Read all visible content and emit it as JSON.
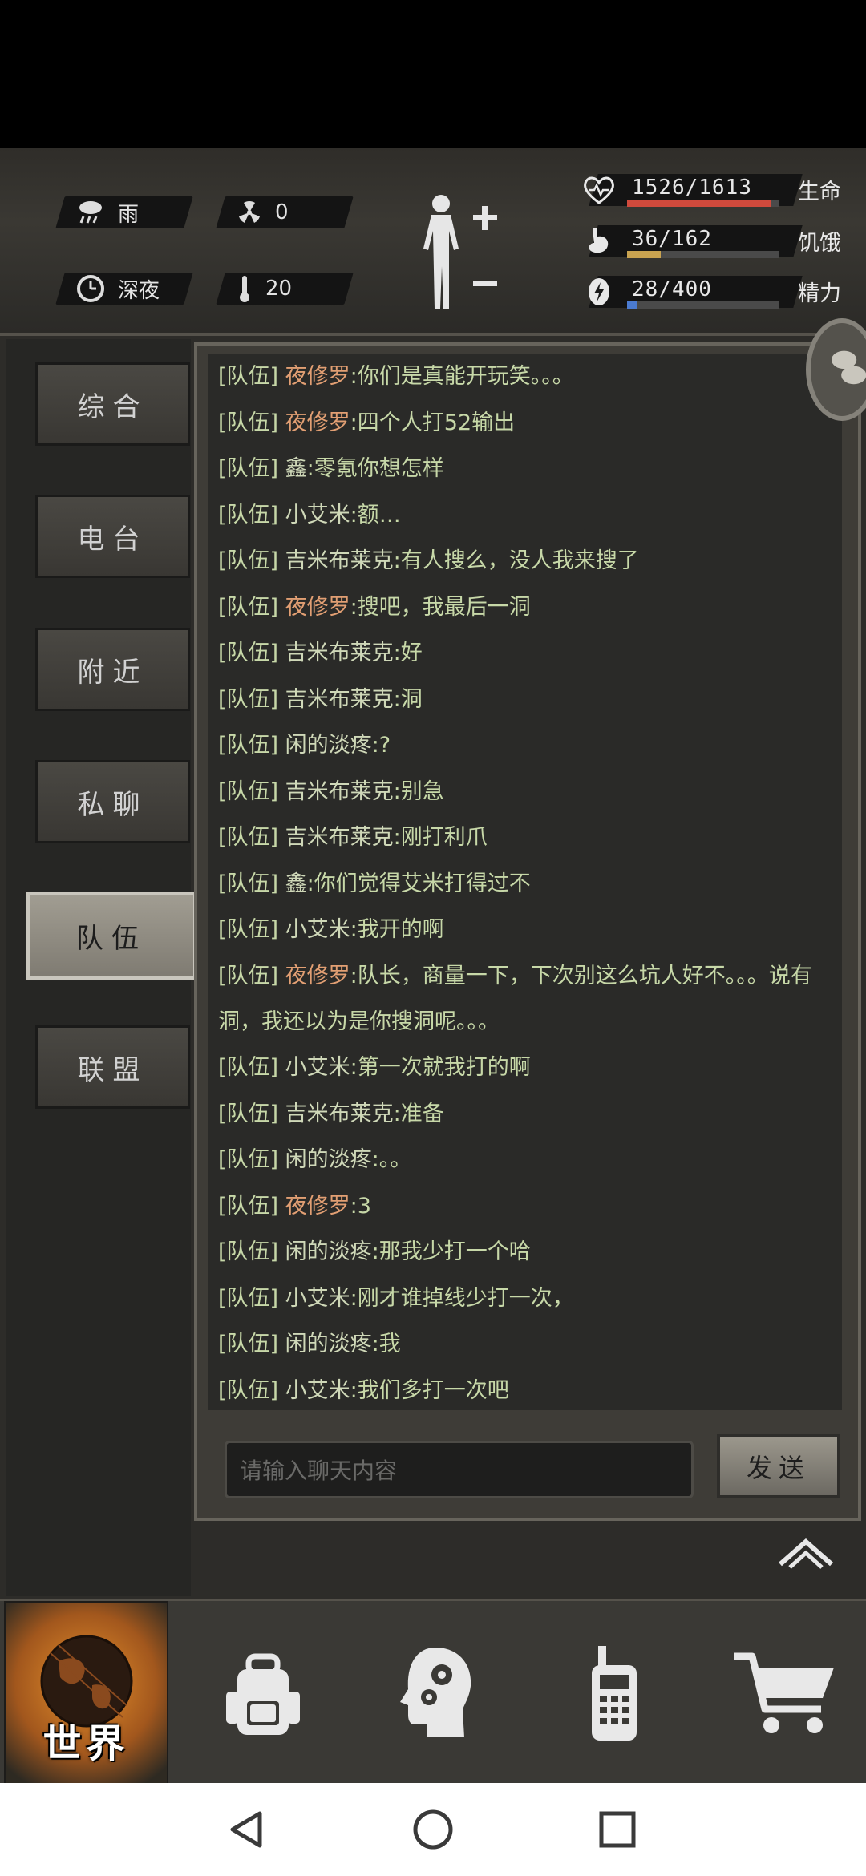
{
  "status": {
    "weather": "雨",
    "radiation": "0",
    "time_of_day": "深夜",
    "temperature": "20",
    "health": {
      "value": "1526/1613",
      "label": "生命",
      "fraction": 0.946,
      "color": "#d04a3c"
    },
    "hunger": {
      "value": "36/162",
      "label": "饥饿",
      "fraction": 0.222,
      "color": "#c9a350"
    },
    "energy": {
      "value": "28/400",
      "label": "精力",
      "fraction": 0.07,
      "color": "#4b7bd1"
    }
  },
  "tabs": [
    {
      "label": "综合"
    },
    {
      "label": "电台"
    },
    {
      "label": "附近"
    },
    {
      "label": "私聊"
    },
    {
      "label": "队伍",
      "active": true
    },
    {
      "label": "联盟"
    }
  ],
  "chat": {
    "messages": [
      {
        "tag": "[队伍]",
        "name": "夜修罗",
        "text": ":你们是真能开玩笑。。。",
        "highlight": true
      },
      {
        "tag": "[队伍]",
        "name": "夜修罗",
        "text": ":四个人打52输出",
        "highlight": true
      },
      {
        "tag": "[队伍]",
        "name": "鑫",
        "text": ":零氪你想怎样",
        "highlight": false
      },
      {
        "tag": "[队伍]",
        "name": "小艾米",
        "text": ":额…",
        "highlight": false
      },
      {
        "tag": "[队伍]",
        "name": "吉米布莱克",
        "text": ":有人搜么，没人我来搜了",
        "highlight": false
      },
      {
        "tag": "[队伍]",
        "name": "夜修罗",
        "text": ":搜吧，我最后一洞",
        "highlight": true
      },
      {
        "tag": "[队伍]",
        "name": "吉米布莱克",
        "text": ":好",
        "highlight": false
      },
      {
        "tag": "[队伍]",
        "name": "吉米布莱克",
        "text": ":洞",
        "highlight": false
      },
      {
        "tag": "[队伍]",
        "name": "闲的淡疼",
        "text": ":?",
        "highlight": false
      },
      {
        "tag": "[队伍]",
        "name": "吉米布莱克",
        "text": ":别急",
        "highlight": false
      },
      {
        "tag": "[队伍]",
        "name": "吉米布莱克",
        "text": ":刚打利爪",
        "highlight": false
      },
      {
        "tag": "[队伍]",
        "name": "鑫",
        "text": ":你们觉得艾米打得过不",
        "highlight": false
      },
      {
        "tag": "[队伍]",
        "name": "小艾米",
        "text": ":我开的啊",
        "highlight": false
      },
      {
        "tag": "[队伍]",
        "name": "夜修罗",
        "text": ":队长，商量一下，下次别这么坑人好不。。。说有洞，我还以为是你搜洞呢。。。",
        "highlight": true
      },
      {
        "tag": "[队伍]",
        "name": "小艾米",
        "text": ":第一次就我打的啊",
        "highlight": false
      },
      {
        "tag": "[队伍]",
        "name": "吉米布莱克",
        "text": ":准备",
        "highlight": false
      },
      {
        "tag": "[队伍]",
        "name": "闲的淡疼",
        "text": ":。。",
        "highlight": false
      },
      {
        "tag": "[队伍]",
        "name": "夜修罗",
        "text": ":3",
        "highlight": true
      },
      {
        "tag": "[队伍]",
        "name": "闲的淡疼",
        "text": ":那我少打一个哈",
        "highlight": false
      },
      {
        "tag": "[队伍]",
        "name": "小艾米",
        "text": ":刚才谁掉线少打一次，",
        "highlight": false
      },
      {
        "tag": "[队伍]",
        "name": "闲的淡疼",
        "text": ":我",
        "highlight": false
      },
      {
        "tag": "[队伍]",
        "name": "小艾米",
        "text": ":我们多打一次吧",
        "highlight": false
      }
    ],
    "input_placeholder": "请输入聊天内容",
    "send_label": "发送"
  },
  "bottom_nav": {
    "world_label": "世界",
    "items": [
      "globe-icon",
      "backpack-icon",
      "skills-head-icon",
      "walkie-talkie-icon",
      "shop-cart-icon"
    ]
  }
}
